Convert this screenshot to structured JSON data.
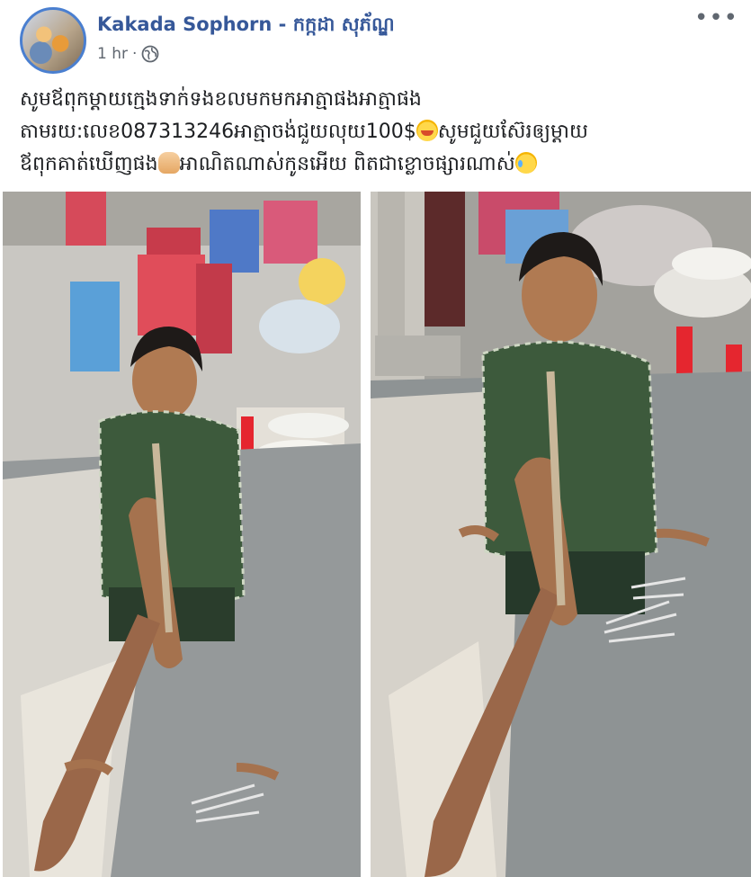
{
  "post": {
    "author": "Kakada Sophorn - កក្កដា សុភ័ណ្ឌ",
    "time": "1 hr",
    "separator": "·",
    "more": "•••",
    "text_line1": "សូមឪពុកម្តាយក្មេងទាក់ទងខលមកមកអាត្មាផងអាត្មាផង",
    "text_line2_a": "តាមរយ:លេខ087313246អាត្មាចង់ជួយលុយ100$",
    "text_line2_b": "សូមជួយស៊ែរឲ្យម្តាយ",
    "text_line3_a": "ឪពុកគាត់ឃើញផង",
    "text_line3_b": "អាណិតណាស់កូនអើយ ពិតជាខ្លោចផ្សារណាស់"
  },
  "icons": {
    "globe": "globe-icon",
    "more": "more-options-icon",
    "emoji1": "crying-face-emoji",
    "emoji2": "praying-hands-emoji",
    "emoji3": "sad-tear-face-emoji"
  },
  "colors": {
    "author": "#365899",
    "meta": "#606770",
    "text": "#1c1e21",
    "avatar_ring": "#4a7fd0"
  }
}
